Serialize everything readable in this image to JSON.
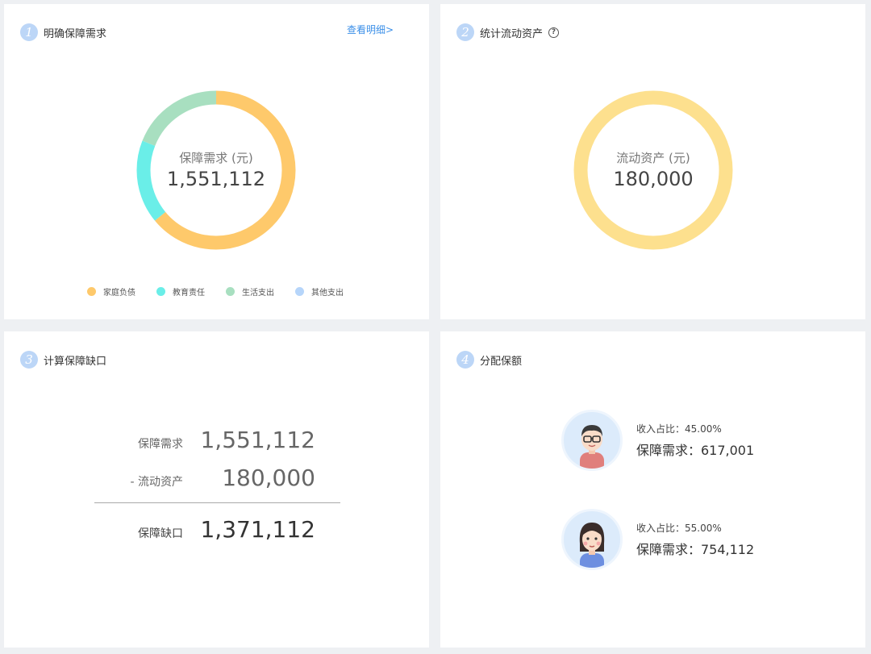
{
  "step1": {
    "number": "1",
    "title": "明确保障需求",
    "link": "查看明细>",
    "center_label": "保障需求 (元)",
    "center_value": "1,551,112",
    "legend": [
      {
        "label": "家庭负债",
        "color": "#fec96b"
      },
      {
        "label": "教育责任",
        "color": "#6aeee8"
      },
      {
        "label": "生活支出",
        "color": "#a8dfc0"
      },
      {
        "label": "其他支出",
        "color": "#b6d5fa"
      }
    ]
  },
  "step2": {
    "number": "2",
    "title": "统计流动资产",
    "help_glyph": "?",
    "center_label": "流动资产 (元)",
    "center_value": "180,000",
    "ring_color": "#fde08e"
  },
  "step3": {
    "number": "3",
    "title": "计算保障缺口",
    "rows": [
      {
        "label": "保障需求",
        "value": "1,551,112"
      },
      {
        "label": "- 流动资产",
        "value": "180,000"
      },
      {
        "label": "保障缺口",
        "value": "1,371,112"
      }
    ]
  },
  "step4": {
    "number": "4",
    "title": "分配保额",
    "people": [
      {
        "avatar": "male-avatar-icon",
        "ratio": "收入占比：45.00%",
        "need": "保障需求：617,001"
      },
      {
        "avatar": "female-avatar-icon",
        "ratio": "收入占比：55.00%",
        "need": "保障需求：754,112"
      }
    ]
  }
}
